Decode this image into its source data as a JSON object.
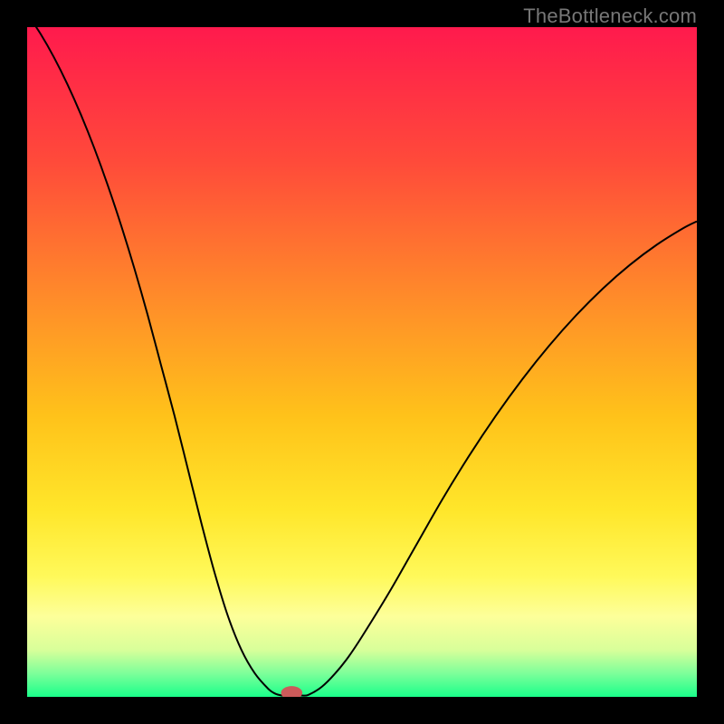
{
  "watermark": "TheBottleneck.com",
  "chart_data": {
    "type": "line",
    "title": "",
    "xlabel": "",
    "ylabel": "",
    "xlim": [
      0,
      100
    ],
    "ylim": [
      0,
      100
    ],
    "background": {
      "type": "vertical-gradient",
      "stops": [
        {
          "offset": 0.0,
          "color": "#ff1a4d"
        },
        {
          "offset": 0.2,
          "color": "#ff4a3a"
        },
        {
          "offset": 0.4,
          "color": "#ff8a2a"
        },
        {
          "offset": 0.58,
          "color": "#ffc21a"
        },
        {
          "offset": 0.72,
          "color": "#ffe62a"
        },
        {
          "offset": 0.82,
          "color": "#fff95a"
        },
        {
          "offset": 0.88,
          "color": "#fdff9a"
        },
        {
          "offset": 0.93,
          "color": "#d8ff9a"
        },
        {
          "offset": 0.965,
          "color": "#7dff9a"
        },
        {
          "offset": 1.0,
          "color": "#1aff8a"
        }
      ]
    },
    "series": [
      {
        "name": "bottleneck-curve",
        "color": "#000000",
        "width": 2,
        "x": [
          0,
          2,
          4,
          6,
          8,
          10,
          12,
          14,
          16,
          18,
          20,
          22,
          24,
          26,
          28,
          30,
          32,
          34,
          36,
          37,
          38,
          38.5,
          38.8,
          39,
          40,
          41,
          42,
          44,
          46,
          48,
          50,
          54,
          58,
          62,
          66,
          70,
          74,
          78,
          82,
          86,
          90,
          94,
          98,
          100
        ],
        "y": [
          102,
          99,
          95.5,
          91.5,
          87,
          82,
          76.5,
          70.5,
          64,
          57,
          49.5,
          42,
          34,
          26,
          18.5,
          12,
          7,
          3.5,
          1.2,
          0.5,
          0.2,
          0.2,
          0.2,
          0.2,
          0.2,
          0.2,
          0.3,
          1.5,
          3.5,
          6,
          9,
          15.5,
          22.5,
          29.5,
          36,
          42,
          47.5,
          52.5,
          57,
          61,
          64.5,
          67.5,
          70,
          71
        ]
      }
    ],
    "marker": {
      "x": 39.5,
      "y": 0.6,
      "rx": 1.6,
      "ry": 1.0,
      "color": "#cc5a5a"
    }
  }
}
